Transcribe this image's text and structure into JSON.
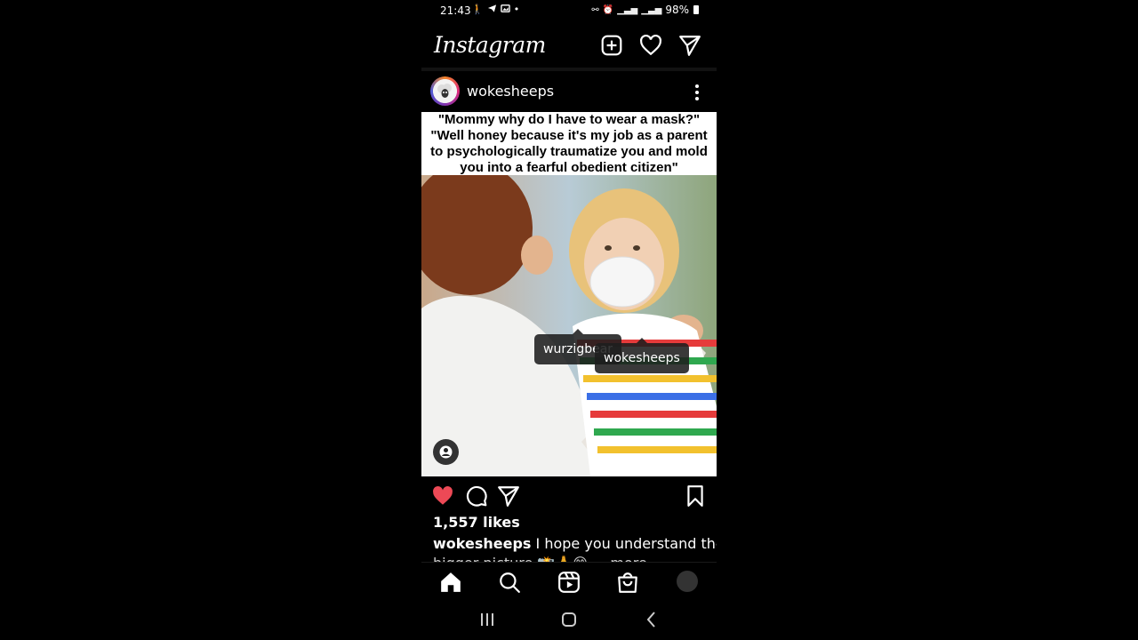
{
  "status_bar": {
    "time": "21:43",
    "left_icons": [
      "walk-icon",
      "telegram-icon",
      "gallery-icon",
      "dot-icon"
    ],
    "right_icons": [
      "link-icon",
      "alarm-icon",
      "signal-4g-icon",
      "signal-icon"
    ],
    "battery": "98%"
  },
  "app": {
    "logo": "Instagram",
    "top_actions": [
      "new-post-icon",
      "activity-heart-icon",
      "direct-message-icon"
    ]
  },
  "post": {
    "username": "wokesheeps",
    "image_caption_lines": [
      "\"Mommy why do I have to wear a mask?\"",
      "\"Well honey because it's my job as a parent",
      "to psychologically traumatize you and mold",
      "you into a fearful obedient citizen\""
    ],
    "tags": [
      "wurzigbear",
      "wokesheeps"
    ],
    "likes": "1,557 likes",
    "caption_user": "wokesheeps",
    "caption_text": "I hope you understand the",
    "caption_text_cut": "bigger picture 📸🙏😊 ... more",
    "liked": true
  },
  "bottom_nav": [
    "home-icon",
    "search-icon",
    "reels-icon",
    "shop-icon",
    "profile-avatar"
  ],
  "system_nav": [
    "recents-icon",
    "home-button-icon",
    "back-icon"
  ],
  "colors": {
    "like_red": "#ed4956",
    "background": "#000000"
  }
}
